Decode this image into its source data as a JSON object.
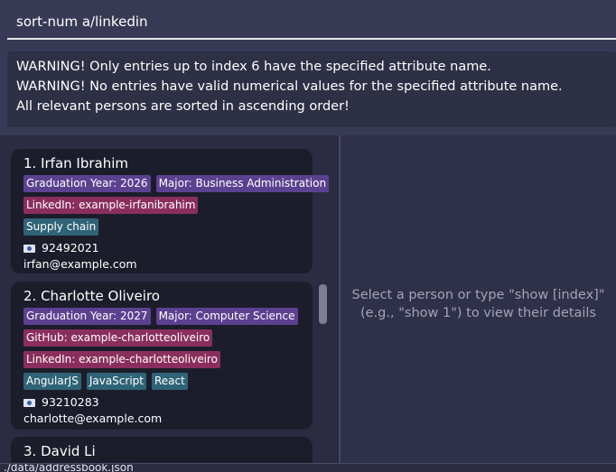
{
  "command": {
    "value": "sort-num a/linkedin"
  },
  "result": {
    "lines": [
      "WARNING! Only entries up to index 6 have the specified attribute name.",
      "WARNING! No entries have valid numerical values for the specified attribute name.",
      "All relevant persons are sorted in ascending order!"
    ]
  },
  "persons": [
    {
      "name": "1. Irfan Ibrahim",
      "tag_rows": [
        [
          "Graduation Year: 2026",
          "Major: Business Administration"
        ],
        [
          "LinkedIn: example-irfanibrahim"
        ],
        [
          "Supply chain"
        ]
      ],
      "phone": "92492021",
      "email": "irfan@example.com"
    },
    {
      "name": "2. Charlotte Oliveiro",
      "tag_rows": [
        [
          "Graduation Year: 2027",
          "Major: Computer Science"
        ],
        [
          "GitHub: example-charlotteoliveiro"
        ],
        [
          "LinkedIn: example-charlotteoliveiro"
        ],
        [
          "AngularJS",
          "JavaScript",
          "React"
        ]
      ],
      "phone": "93210283",
      "email": "charlotte@example.com"
    },
    {
      "name": "3. David Li"
    }
  ],
  "detail": {
    "placeholder_line1": "Select a person or type \"show [index]\"",
    "placeholder_line2": "(e.g., \"show 1\") to view their details"
  },
  "status": {
    "text": "./data/addressbook.json"
  },
  "colors": {
    "background": "#383a55",
    "card": "#1c1d2b",
    "tag_attribute": "#5c4190",
    "tag_link": "#8a2f5d",
    "tag_skill": "#2f6377"
  },
  "icons": {
    "phone": "phone-icon"
  }
}
